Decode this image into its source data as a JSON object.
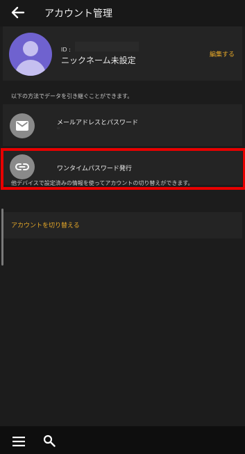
{
  "header": {
    "title": "アカウント管理"
  },
  "profile": {
    "id_label": "ID :",
    "nickname": "ニックネーム未設定",
    "edit_label": "編集する"
  },
  "transfer": {
    "note": "以下の方法でデータを引き継ぐことができます。",
    "email_label": "メールアドレスとパスワード",
    "otp_label": "ワンタイムパスワード発行"
  },
  "switch": {
    "note": "他デバイスで設定済みの情報を使ってアカウントの切り替えができます。",
    "link_label": "アカウントを切り替える"
  },
  "icons": {
    "back": "arrow-left-icon",
    "mail": "mail-icon",
    "link": "link-icon",
    "menu": "menu-icon",
    "search": "search-icon"
  },
  "colors": {
    "accent": "#e7a929",
    "avatar": "#6f62cf",
    "highlight": "#e80000",
    "background": "#1c1c1c"
  }
}
